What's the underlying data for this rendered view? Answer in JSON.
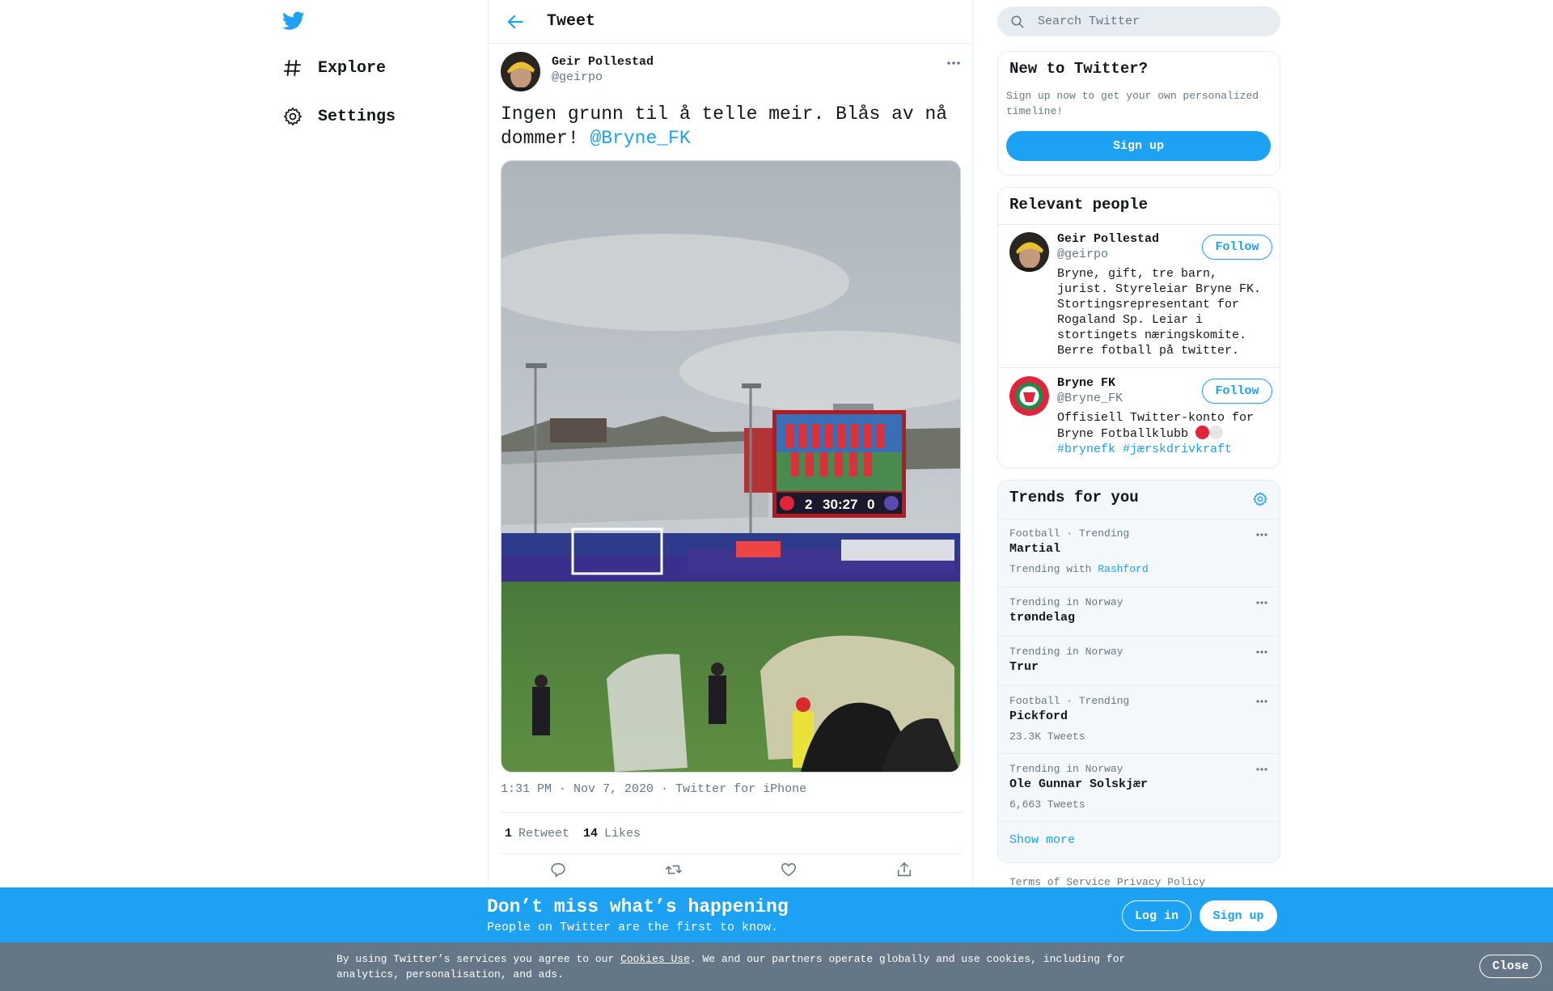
{
  "nav": {
    "items": [
      {
        "label": "Explore",
        "icon": "hashtag-icon"
      },
      {
        "label": "Settings",
        "icon": "gear-icon"
      }
    ]
  },
  "header": {
    "title": "Tweet"
  },
  "tweet": {
    "author_name": "Geir Pollestad",
    "author_handle": "@geirpo",
    "text": "Ingen grunn til å telle meir. Blås av nå dommer!",
    "mention": "@Bryne_FK",
    "time": "1:31 PM · Nov 7, 2020",
    "source": "Twitter for iPhone",
    "retweets_count": "1",
    "retweets_label": "Retweet",
    "likes_count": "14",
    "likes_label": "Likes",
    "scoreboard": {
      "home": "2",
      "clock": "30:27",
      "away": "0"
    }
  },
  "search": {
    "placeholder": "Search Twitter"
  },
  "new_panel": {
    "title": "New to Twitter?",
    "text": "Sign up now to get your own personalized timeline!",
    "button": "Sign up"
  },
  "relevant": {
    "title": "Relevant people",
    "people": [
      {
        "name": "Geir Pollestad",
        "handle": "@geirpo",
        "follow": "Follow",
        "bio": "Bryne, gift, tre barn, jurist. Styreleiar Bryne FK. Stortingsrepresentant for Rogaland Sp. Leiar i stortingets næringskomite. Berre fotball på twitter."
      },
      {
        "name": "Bryne FK",
        "handle": "@Bryne_FK",
        "follow": "Follow",
        "bio": "Offisiell Twitter-konto for Bryne Fotballklubb",
        "hashtags": "#brynefk #jærskdrivkraft"
      }
    ]
  },
  "trends": {
    "title": "Trends for you",
    "items": [
      {
        "context": "Football · Trending",
        "name": "Martial",
        "sub_prefix": "Trending with ",
        "sub_link": "Rashford"
      },
      {
        "context": "Trending in Norway",
        "name": "trøndelag"
      },
      {
        "context": "Trending in Norway",
        "name": "Trur"
      },
      {
        "context": "Football · Trending",
        "name": "Pickford",
        "sub": "23.3K Tweets"
      },
      {
        "context": "Trending in Norway",
        "name": "Ole Gunnar Solskjær",
        "sub": "6,663 Tweets"
      }
    ],
    "show_more": "Show more"
  },
  "footer": {
    "terms": "Terms of Service",
    "privacy": "Privacy Policy"
  },
  "banner": {
    "heading": "Don’t miss what’s happening",
    "subtext": "People on Twitter are the first to know.",
    "login": "Log in",
    "signup": "Sign up"
  },
  "cookie": {
    "pre": "By using Twitter’s services you agree to our ",
    "link": "Cookies Use",
    "post": ". We and our partners operate globally and use cookies, including for analytics, personalisation, and ads.",
    "close": "Close"
  },
  "colors": {
    "brand": "#1da1f2",
    "cookie_bg": "#657786",
    "bryne_red": "#e0243c"
  }
}
